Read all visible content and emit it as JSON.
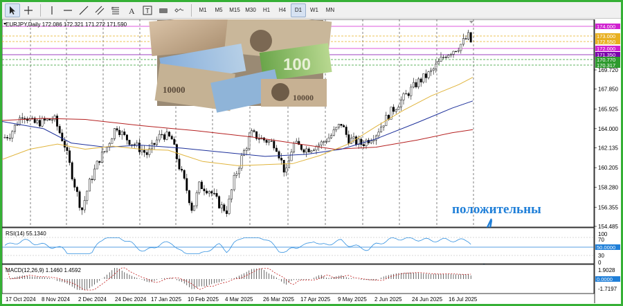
{
  "toolbar": {
    "tools": [
      "cursor-icon",
      "crosshair-icon",
      "vertical-line-icon",
      "horizontal-line-icon",
      "trendline-icon",
      "channel-icon",
      "fibonacci-icon",
      "text-icon",
      "text-label-icon",
      "rectangle-icon",
      "shapes-icon"
    ],
    "timeframes": [
      "M1",
      "M5",
      "M15",
      "M30",
      "H1",
      "H4",
      "D1",
      "W1",
      "MN"
    ],
    "active_timeframe": "D1"
  },
  "main_chart": {
    "symbol_line": "EURJPY,Daily  172.086 172.321 171.272 171.590",
    "price_ticks": [
      "169.720",
      "167.850",
      "165.925",
      "164.000",
      "162.135",
      "160.205",
      "158.280",
      "156.355",
      "154.485"
    ],
    "level_labels": [
      {
        "text": "174.000",
        "color": "#d020d0"
      },
      {
        "text": "173.000",
        "color": "#e8b020"
      },
      {
        "text": "172.550",
        "color": "#e8b020"
      },
      {
        "text": "172.000",
        "color": "#d020d0"
      },
      {
        "text": "171.350",
        "color": "#7a00aa"
      },
      {
        "text": "170.770",
        "color": "#2e9a2e"
      },
      {
        "text": "170.317",
        "color": "#2e9a2e"
      }
    ],
    "date_labels": [
      "17 Oct 2024",
      "8 Nov 2024",
      "2 Dec 2024",
      "24 Dec 2024",
      "17 Jan 2025",
      "10 Feb 2025",
      "4 Mar 2025",
      "26 Mar 2025",
      "17 Apr 2025",
      "9 May 2025",
      "2 Jun 2025",
      "24 Jun 2025",
      "16 Jul 2025"
    ],
    "annotation": "положительны"
  },
  "rsi": {
    "label": "RSI(14) 55.1340",
    "ticks": [
      "100",
      "70",
      "50.0000",
      "30",
      "0"
    ]
  },
  "macd": {
    "label": "MACD(12,26,9) 1.1460 1.4592",
    "ticks": [
      "1.9028",
      "0.0000",
      "-1.7197"
    ]
  },
  "colors": {
    "accent_green": "#35b035",
    "annotation_blue": "#1f7fd8",
    "ma_fast": "#e0b43c",
    "ma_mid": "#1c2f9a",
    "ma_slow": "#b52020"
  }
}
